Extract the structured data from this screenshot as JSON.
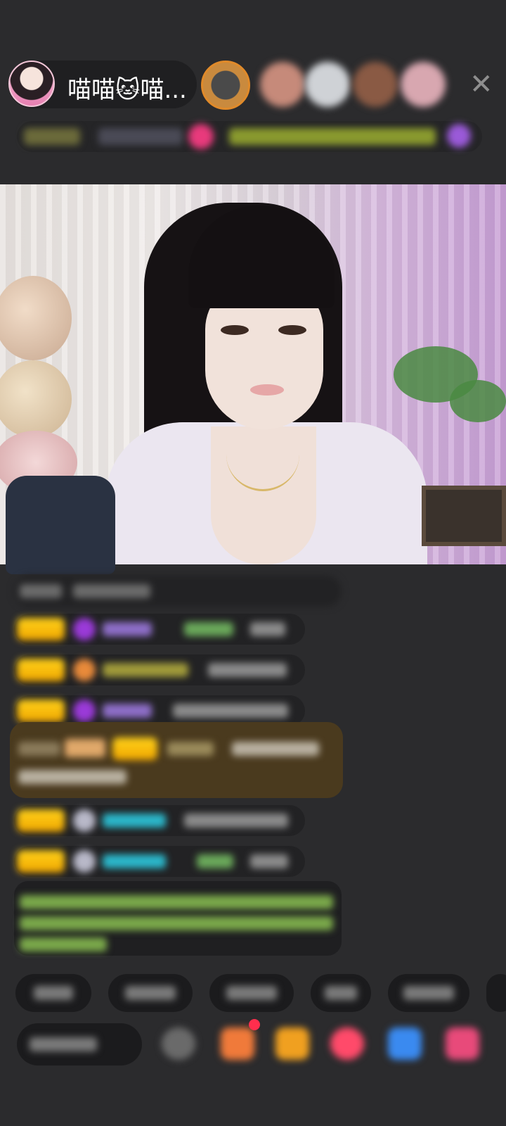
{
  "host": {
    "name": "喵喵🐱喵..."
  },
  "header": {
    "close_icon": "close-icon"
  },
  "viewers": [
    {
      "color": "#c98a3e"
    },
    {
      "color": "#c68a7a"
    },
    {
      "color": "#cfd2d6"
    },
    {
      "color": "#8a5a44"
    },
    {
      "color": "#d8a7b0"
    }
  ],
  "video": {
    "scene": "live-stream"
  },
  "colors": {
    "badge_gold": "#ffc21a",
    "gift_bubble": "#4a3a1e",
    "green_text": "#8ec84a",
    "cyan_text": "#2bb6c9",
    "purple_text": "#9d7bd8"
  }
}
